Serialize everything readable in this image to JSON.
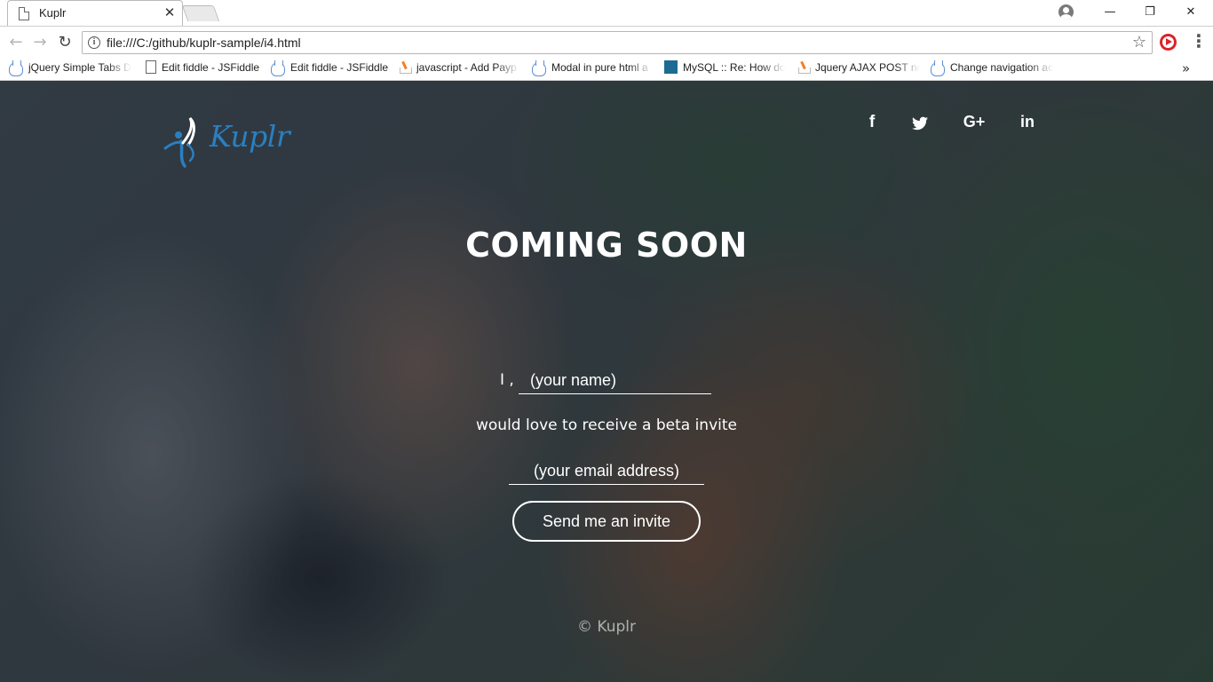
{
  "browser": {
    "tab_title": "Kuplr",
    "tab_close": "✕",
    "url": "file:///C:/github/kuplr-sample/i4.html",
    "window_buttons": {
      "minimize": "—",
      "restore": "❐",
      "close": "✕"
    },
    "bookmarks": [
      {
        "label": "jQuery Simple Tabs D",
        "icon": "jsfiddle-cloud-icon"
      },
      {
        "label": "Edit fiddle - JSFiddle",
        "icon": "page-icon"
      },
      {
        "label": "Edit fiddle - JSFiddle",
        "icon": "jsfiddle-cloud-icon"
      },
      {
        "label": "javascript - Add Payp",
        "icon": "stackoverflow-icon"
      },
      {
        "label": "Modal in pure html a",
        "icon": "jsfiddle-cloud-icon"
      },
      {
        "label": "MySQL :: Re: How do",
        "icon": "mysql-icon"
      },
      {
        "label": "Jquery AJAX POST nc",
        "icon": "stackoverflow-icon"
      },
      {
        "label": "Change navigation ac",
        "icon": "jsfiddle-cloud-icon"
      }
    ],
    "more_bookmarks": "»"
  },
  "page": {
    "logo_text": "Kuplr",
    "social": {
      "facebook": "f",
      "google_plus": "G+",
      "linkedin": "in"
    },
    "headline": "COMING SOON",
    "i_label": "I ,",
    "name_placeholder": "(your name)",
    "beta_text": "would love to receive a beta invite",
    "email_placeholder": "(your email address)",
    "invite_button": "Send me an invite",
    "footer": "© Kuplr"
  },
  "colors": {
    "logo_blue": "#2a7fc0",
    "text_white": "#ffffff",
    "extension_red": "#d9242a"
  }
}
